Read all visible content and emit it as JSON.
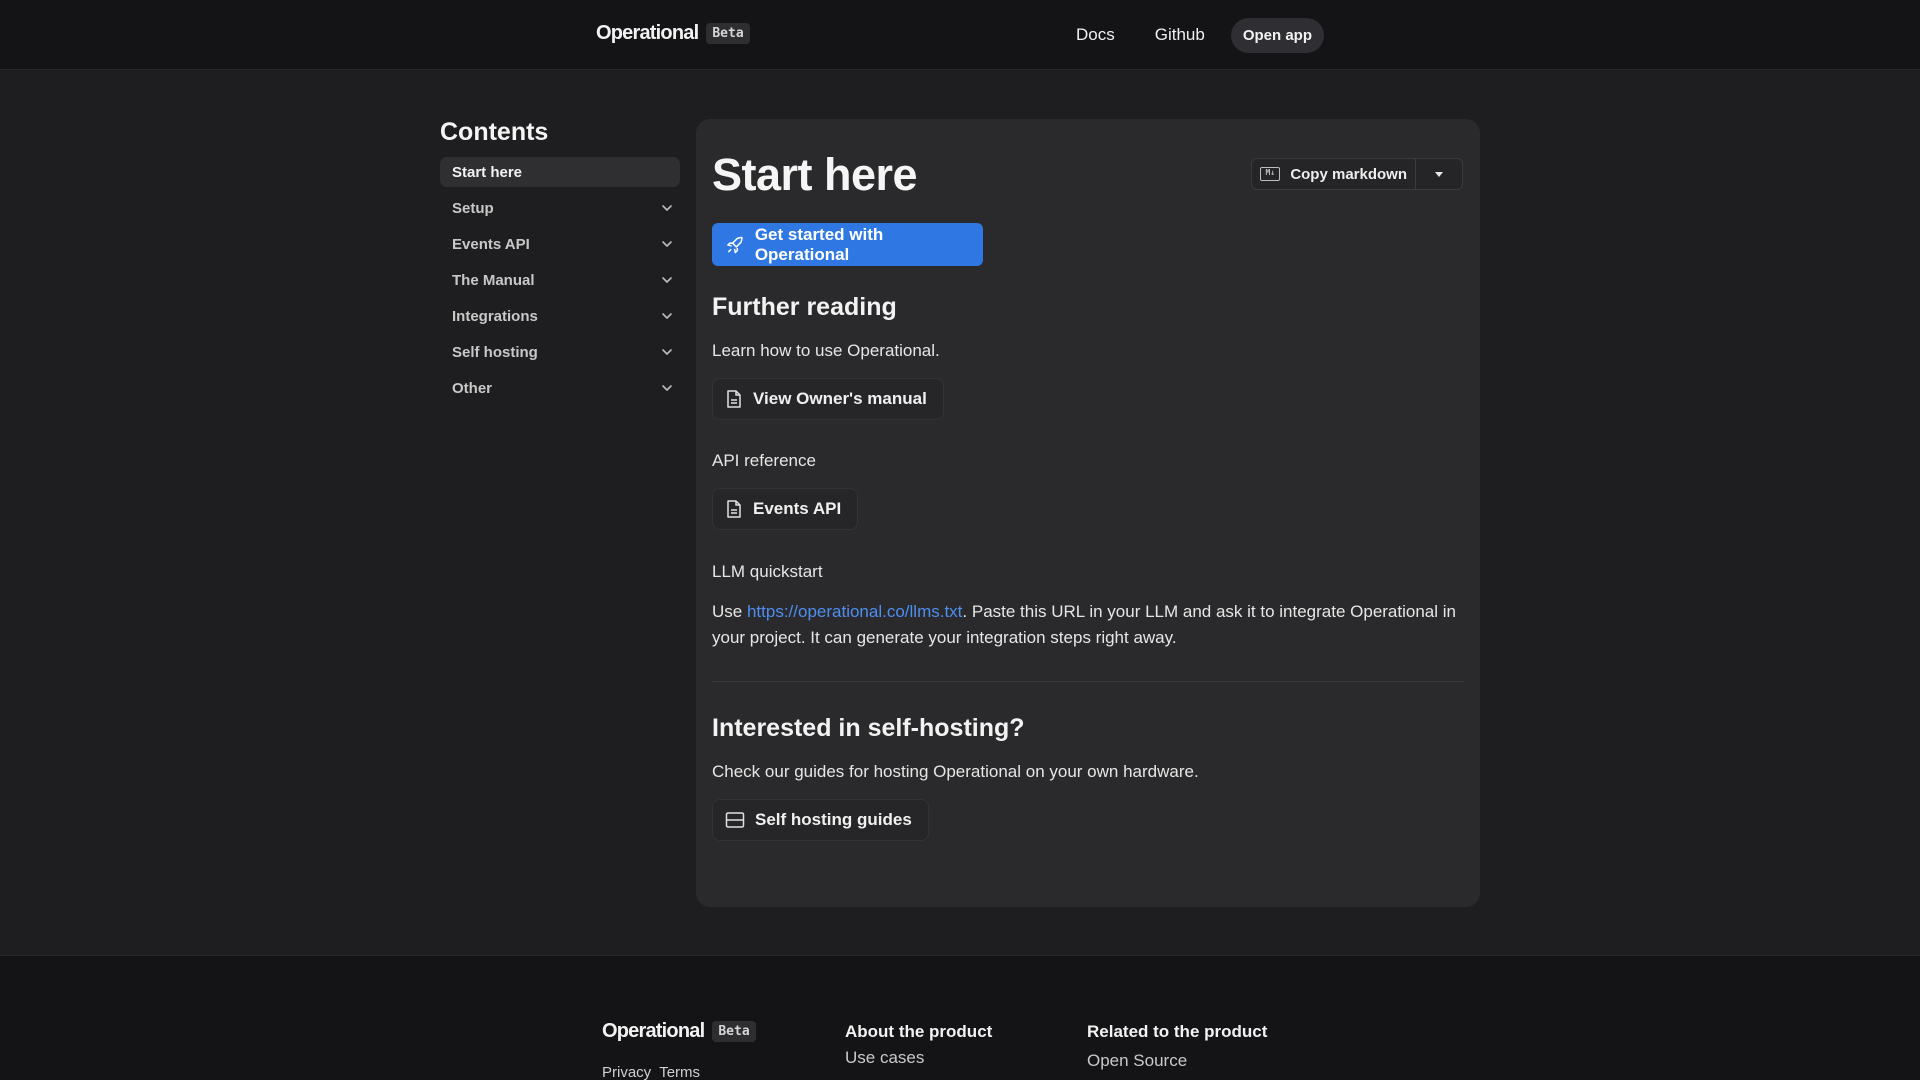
{
  "header": {
    "brand": "Operational",
    "badge": "Beta",
    "nav": {
      "docs": "Docs",
      "github": "Github",
      "open_app": "Open app"
    }
  },
  "sidebar": {
    "title": "Contents",
    "items": [
      {
        "label": "Start here",
        "active": true
      },
      {
        "label": "Setup"
      },
      {
        "label": "Events API"
      },
      {
        "label": "The Manual"
      },
      {
        "label": "Integrations"
      },
      {
        "label": "Self hosting"
      },
      {
        "label": "Other"
      }
    ]
  },
  "main": {
    "title": "Start here",
    "copy_markdown": "Copy markdown",
    "md_icon": "M↓",
    "cta": "Get started with Operational",
    "further_reading": {
      "heading": "Further reading",
      "intro": "Learn how to use Operational.",
      "owners_manual": "View Owner's manual",
      "api_label": "API reference",
      "events_api": "Events API",
      "llm_label": "LLM quickstart",
      "llm_prefix": "Use ",
      "llm_link": "https://operational.co/llms.txt",
      "llm_suffix": ". Paste this URL in your LLM and ask it to integrate Operational in your project. It can generate your integration steps right away."
    },
    "self_hosting": {
      "heading": "Interested in self-hosting?",
      "text": "Check our guides for hosting Operational on your own hardware.",
      "button": "Self hosting guides"
    }
  },
  "footer": {
    "brand": "Operational",
    "badge": "Beta",
    "links": [
      "Privacy",
      "Terms"
    ],
    "about": {
      "title": "About the product",
      "item": "Use cases"
    },
    "related": {
      "title": "Related to the product",
      "item": "Open Source"
    }
  },
  "colors": {
    "accent": "#2f78e4",
    "link": "#4d8eef",
    "background": "#1e1e20",
    "card": "#2a2a2c"
  }
}
